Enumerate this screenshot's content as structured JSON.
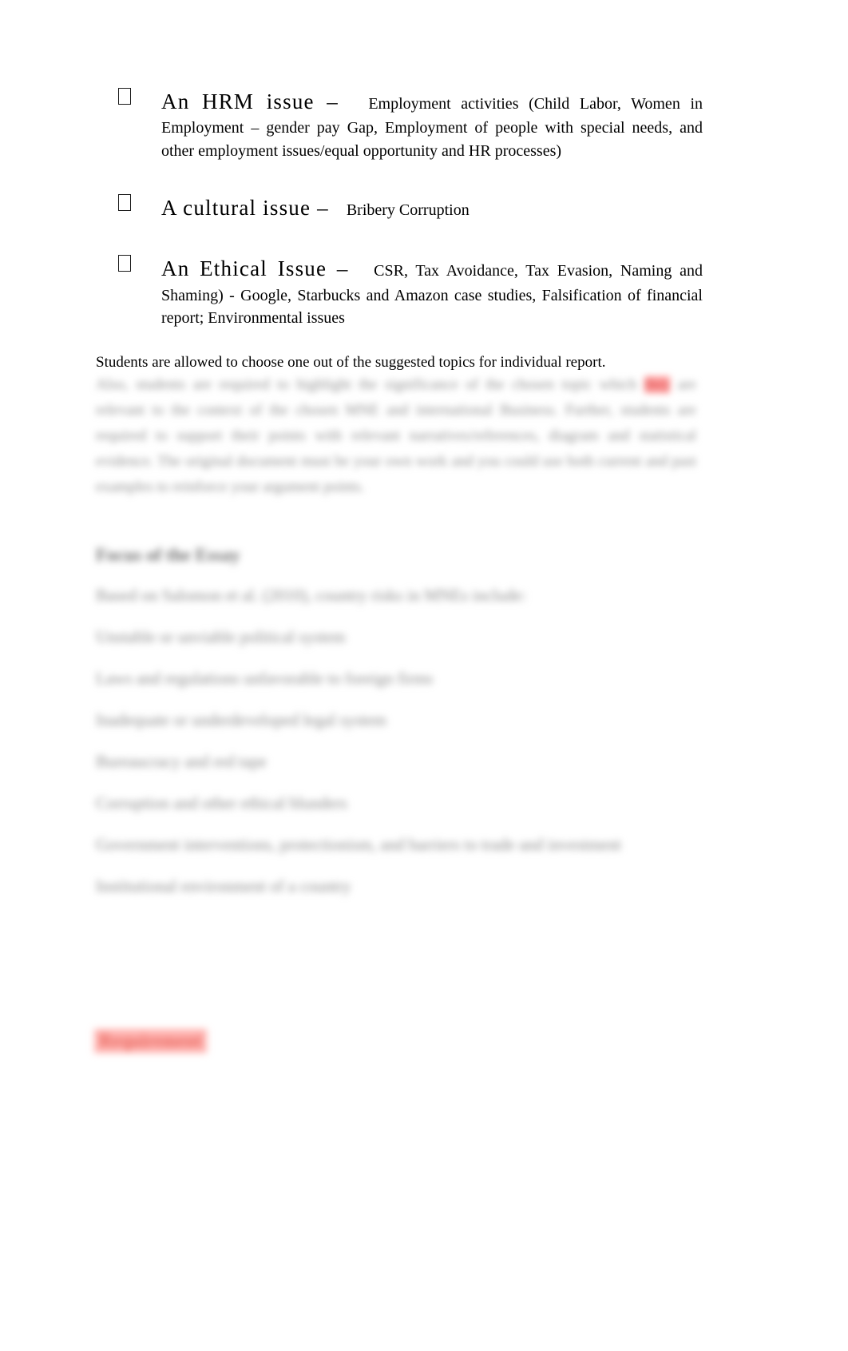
{
  "document": {
    "bullets": [
      {
        "glyph": "square-bullet-glyph",
        "lead": "An HRM issue –",
        "trail": "Employment activities (Child Labor, Women in Employment – gender pay Gap, Employment of people with special needs, and other employment issues/equal opportunity and HR processes)"
      },
      {
        "glyph": "square-bullet-glyph",
        "lead": "A cultural issue –",
        "trail": "Bribery Corruption"
      },
      {
        "glyph": "square-bullet-glyph",
        "lead": "An Ethical Issue –",
        "trail": "CSR, Tax Avoidance, Tax Evasion, Naming and Shaming) - Google, Starbucks and Amazon case studies, Falsification of financial report; Environmental issues"
      }
    ],
    "note": "Students are allowed to choose one out of the suggested topics for individual report.",
    "blurred_paragraph": {
      "pre_highlight": "Also, students are required to highlight the significance of the chosen topic which",
      "highlight": "they",
      "post_highlight": "are relevant to the context of the chosen MNE and international Business. Further, students are required to support their points with relevant narratives/references, diagram and statistical evidence. The original document must be your own work and you could use both current and past examples to reinforce your argument points."
    },
    "blurred_heading": "Focus of the Essay",
    "blurred_list": [
      "Based on Salomon et al. (2010), country risks in MNEs include:",
      "Unstable or unviable political system",
      "Laws and regulations unfavorable to foreign firms",
      "Inadequate or underdeveloped legal system",
      "Bureaucracy and red tape",
      "Corruption and other ethical blunders",
      "Government interventions, protectionism, and barriers to trade and investment",
      "Institutional environment of a country"
    ],
    "blurred_requirement": "Requirement",
    "colors": {
      "highlight_red": "#ff9a9a",
      "requirement_red": "#e8685f",
      "requirement_highlight": "#ffb3b0",
      "blur_grey": "#8a8a8a",
      "text_black": "#000000",
      "page_background": "#ffffff"
    }
  }
}
